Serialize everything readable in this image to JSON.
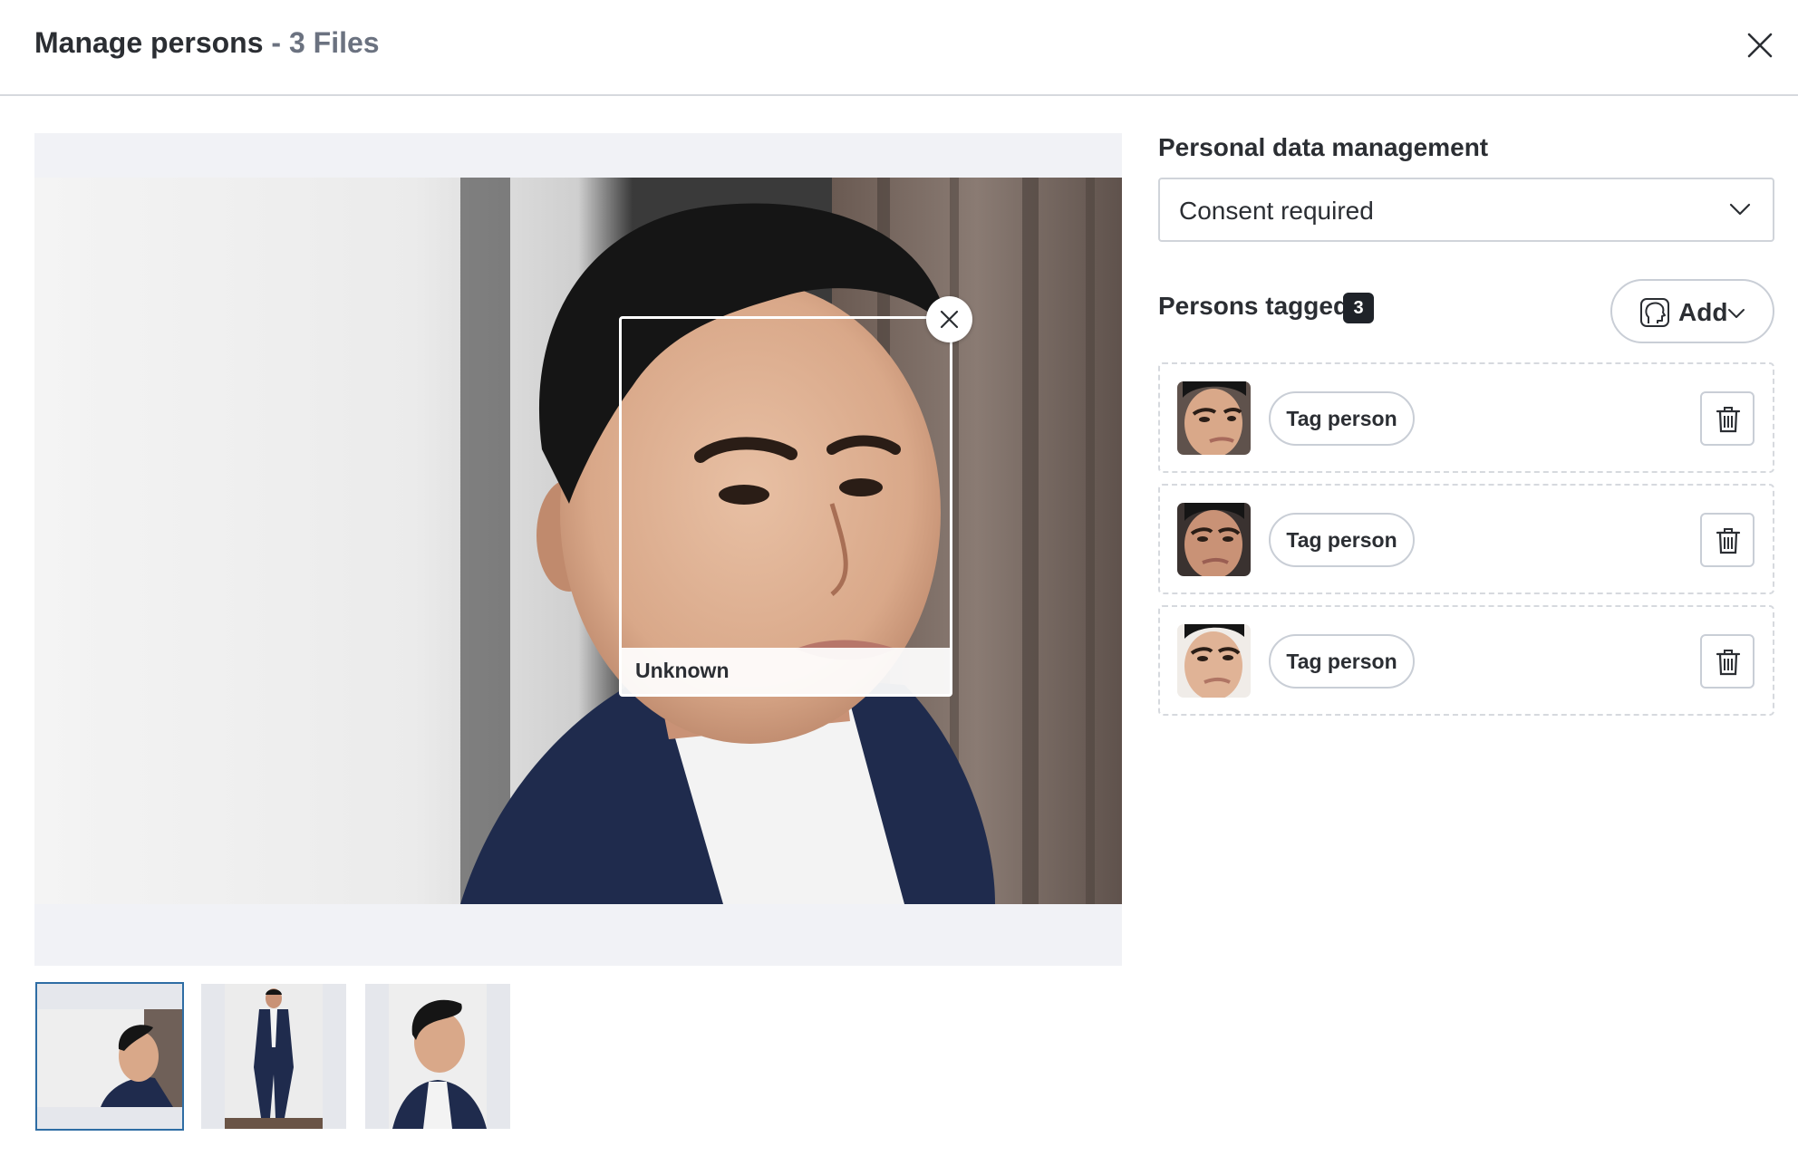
{
  "header": {
    "title": "Manage persons",
    "subtitle": "- 3 Files",
    "close_icon": "close-icon"
  },
  "viewer": {
    "face_label": "Unknown",
    "remove_face_icon": "close-icon",
    "thumbnails": [
      {
        "label": "file-1",
        "selected": true
      },
      {
        "label": "file-2",
        "selected": false
      },
      {
        "label": "file-3",
        "selected": false
      }
    ]
  },
  "panel": {
    "data_label": "Personal data management",
    "data_select_value": "Consent required",
    "tagged_label": "Persons tagged",
    "tagged_count": "3",
    "add_label": "Add",
    "add_icon": "face-icon",
    "persons": [
      {
        "tag_label": "Tag person",
        "delete_icon": "trash-icon"
      },
      {
        "tag_label": "Tag person",
        "delete_icon": "trash-icon"
      },
      {
        "tag_label": "Tag person",
        "delete_icon": "trash-icon"
      }
    ]
  },
  "colors": {
    "accent": "#2e6da4",
    "text": "#2b2e33",
    "muted": "#6b7280",
    "badge": "#1f2329"
  }
}
